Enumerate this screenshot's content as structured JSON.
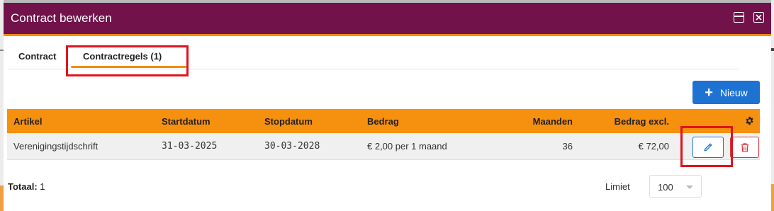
{
  "window": {
    "title": "Contract bewerken"
  },
  "tabs": [
    {
      "label": "Contract"
    },
    {
      "label": "Contractregels (1)"
    }
  ],
  "toolbar": {
    "new_label": "Nieuw"
  },
  "table": {
    "headers": [
      "Artikel",
      "Startdatum",
      "Stopdatum",
      "Bedrag",
      "Maanden",
      "Bedrag excl."
    ],
    "rows": [
      [
        "Verenigingstijdschrift",
        "31-03-2025",
        "30-03-2028",
        "€ 2,00 per 1 maand",
        "36",
        "€ 72,00"
      ]
    ]
  },
  "footer": {
    "total_label": "Totaal:",
    "total_value": "1",
    "limit_label": "Limiet",
    "limit_value": "100"
  },
  "colors": {
    "titlebar": "#72124a",
    "accent": "#f28c0f",
    "primary": "#1e72d2",
    "danger": "#d9363e",
    "highlight": "#e0141e"
  },
  "icons": {
    "restore": "window-restore-icon",
    "close": "window-close-icon",
    "plus": "plus-icon",
    "gear": "gear-icon",
    "edit": "pencil-icon",
    "delete": "trash-icon",
    "caret": "chevron-down-icon"
  }
}
